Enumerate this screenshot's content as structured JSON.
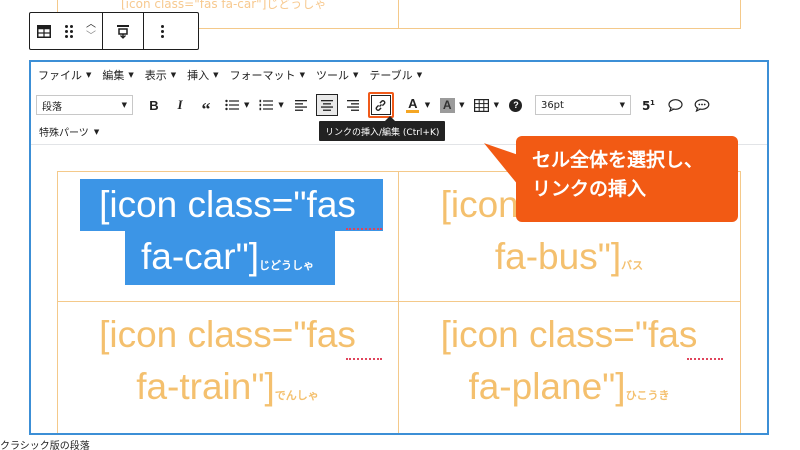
{
  "previous_block": {
    "cell_text": "[icon class=\"fas fa-car\"]じどうしゃ"
  },
  "block_toolbar": {
    "table_icon": "table-icon",
    "drag_icon": "drag-handle-icon",
    "move_up_icon": "chevron-up-icon",
    "move_down_icon": "chevron-down-icon",
    "align_icon": "vertical-align-icon",
    "more_icon": "more-options-icon"
  },
  "menubar": {
    "items": [
      {
        "label": "ファイル"
      },
      {
        "label": "編集"
      },
      {
        "label": "表示"
      },
      {
        "label": "挿入"
      },
      {
        "label": "フォーマット"
      },
      {
        "label": "ツール"
      },
      {
        "label": "テーブル"
      }
    ]
  },
  "toolbar": {
    "format_select": "段落",
    "font_size_select": "36pt",
    "second_row_label": "特殊パーツ",
    "tooltip": "リンクの挿入/編集 (Ctrl+K)",
    "highlight_color": "#f05a1a",
    "font_color": "#f5a623"
  },
  "table": {
    "cells": [
      {
        "main_line1": "[icon class=\"fas",
        "main_line2": "fa-car\"]",
        "ruby": "じどうしゃ",
        "selected": true
      },
      {
        "main_line1": "[icon class=\"fas",
        "main_line2": "fa-bus\"]",
        "ruby": "バス",
        "selected": false
      },
      {
        "main_line1": "[icon class=\"fas",
        "main_line2": "fa-train\"]",
        "ruby": "でんしゃ",
        "selected": false
      },
      {
        "main_line1": "[icon class=\"fas",
        "main_line2": "fa-plane\"]",
        "ruby": "ひこうき",
        "selected": false
      }
    ],
    "text_color": "#f4c06e",
    "selection_color": "#3c95e6"
  },
  "callout": {
    "line1": "セル全体を選択し、",
    "line2": "リンクの挿入",
    "color": "#f25a14"
  },
  "footer": {
    "block_label": "クラシック版の段落"
  }
}
